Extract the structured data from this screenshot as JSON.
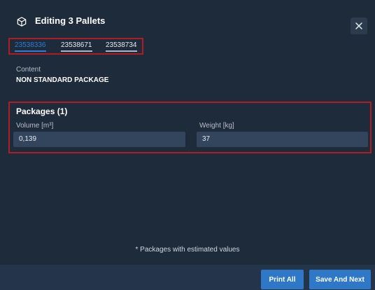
{
  "header": {
    "title": "Editing 3 Pallets",
    "icon": "package-icon"
  },
  "tabs": [
    {
      "label": "23538336",
      "active": true
    },
    {
      "label": "23538671",
      "active": false
    },
    {
      "label": "23538734",
      "active": false
    }
  ],
  "content": {
    "label": "Content",
    "value": "NON STANDARD PACKAGE"
  },
  "packages": {
    "title": "Packages (1)",
    "volume_label": "Volume [m³]",
    "volume_value": "0,139",
    "weight_label": "Weight [kg]",
    "weight_value": "37"
  },
  "footnote": "* Packages with estimated values",
  "footer": {
    "print_all": "Print All",
    "save_next": "Save And Next"
  },
  "colors": {
    "background": "#1e2b3b",
    "accent": "#2f78c8",
    "highlight_border": "#b01c24"
  }
}
